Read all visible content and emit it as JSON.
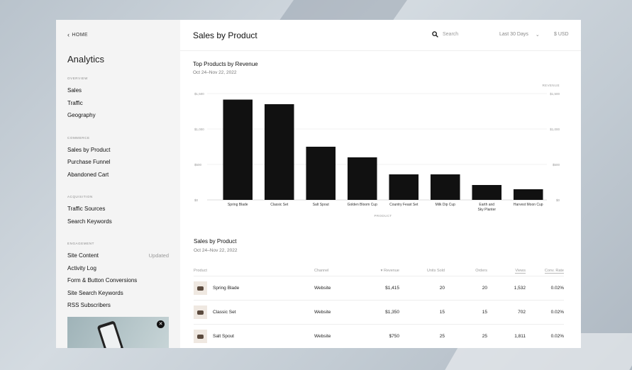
{
  "sidebar": {
    "back": "HOME",
    "title": "Analytics",
    "sections": [
      {
        "label": "OVERVIEW",
        "items": [
          "Sales",
          "Traffic",
          "Geography"
        ]
      },
      {
        "label": "COMMERCE",
        "items": [
          "Sales by Product",
          "Purchase Funnel",
          "Abandoned Cart"
        ]
      },
      {
        "label": "ACQUISITION",
        "items": [
          "Traffic Sources",
          "Search Keywords"
        ]
      },
      {
        "label": "ENGAGEMENT",
        "items": [
          "Site Content",
          "Activity Log",
          "Form & Button Conversions",
          "Site Search Keywords",
          "RSS Subscribers"
        ]
      }
    ],
    "site_content_badge": "Updated"
  },
  "header": {
    "title": "Sales by Product",
    "search_placeholder": "Search",
    "date_range": "Last 30 Days",
    "currency": "$ USD"
  },
  "chart_section": {
    "title": "Top Products by Revenue",
    "subtitle": "Oct 24–Nov 22, 2022"
  },
  "chart_data": {
    "type": "bar",
    "categories": [
      "Spring Blade",
      "Classic Set",
      "Salt Spout",
      "Golden Bloom Cup",
      "Country Feast Set",
      "Milk Dip Cup",
      "Earth and Sky Planter",
      "Harvest Moon Cup"
    ],
    "values": [
      1415,
      1350,
      750,
      600,
      360,
      360,
      210,
      150
    ],
    "xlabel": "PRODUCT",
    "ylabel": "REVENUE",
    "ylim": [
      0,
      1500
    ],
    "yticks": [
      0,
      500,
      1000,
      1500
    ],
    "ytick_labels": [
      "$0",
      "$500",
      "$1,000",
      "$1,500"
    ],
    "grid": true,
    "bar_color": "#111111"
  },
  "table_section": {
    "title": "Sales by Product",
    "subtitle": "Oct 24–Nov 22, 2022",
    "columns": [
      "Product",
      "Channel",
      "Revenue",
      "Units Sold",
      "Orders",
      "Views",
      "Conv. Rate"
    ],
    "rows": [
      {
        "product": "Spring Blade",
        "channel": "Website",
        "revenue": "$1,415",
        "units": "20",
        "orders": "20",
        "views": "1,532",
        "conv": "0.02%"
      },
      {
        "product": "Classic Set",
        "channel": "Website",
        "revenue": "$1,350",
        "units": "15",
        "orders": "15",
        "views": "702",
        "conv": "0.02%"
      },
      {
        "product": "Salt Spout",
        "channel": "Website",
        "revenue": "$750",
        "units": "25",
        "orders": "25",
        "views": "1,811",
        "conv": "0.02%"
      }
    ]
  }
}
